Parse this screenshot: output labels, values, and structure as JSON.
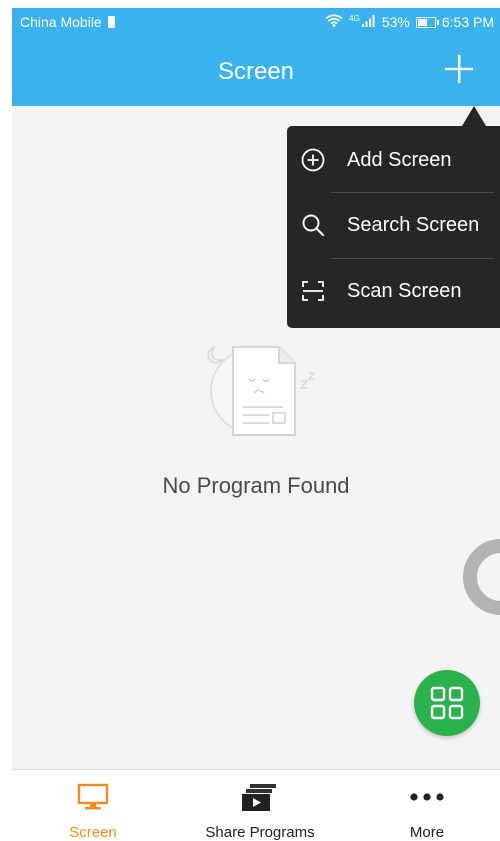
{
  "status_bar": {
    "carrier": "China Mobile",
    "network": "4G",
    "battery": "53%",
    "time": "6:53 PM"
  },
  "header": {
    "title": "Screen"
  },
  "menu": {
    "items": [
      {
        "label": "Add Screen",
        "icon": "plus-circle-icon"
      },
      {
        "label": "Search Screen",
        "icon": "search-icon"
      },
      {
        "label": "Scan Screen",
        "icon": "scan-icon"
      }
    ]
  },
  "empty_state": {
    "message": "No Program Found",
    "illustration": "sleeping-document-icon"
  },
  "fab": {
    "icon": "grid-icon"
  },
  "bottom_nav": {
    "items": [
      {
        "label": "Screen",
        "icon": "monitor-icon",
        "active": true
      },
      {
        "label": "Share Programs",
        "icon": "share-programs-icon",
        "active": false
      },
      {
        "label": "More",
        "icon": "more-dots-icon",
        "active": false
      }
    ]
  },
  "colors": {
    "header_bg": "#3ab2ef",
    "menu_bg": "#262626",
    "fab_bg": "#2bb24c",
    "active_tab": "#f08c1e",
    "page_bg": "#f4f4f4"
  }
}
